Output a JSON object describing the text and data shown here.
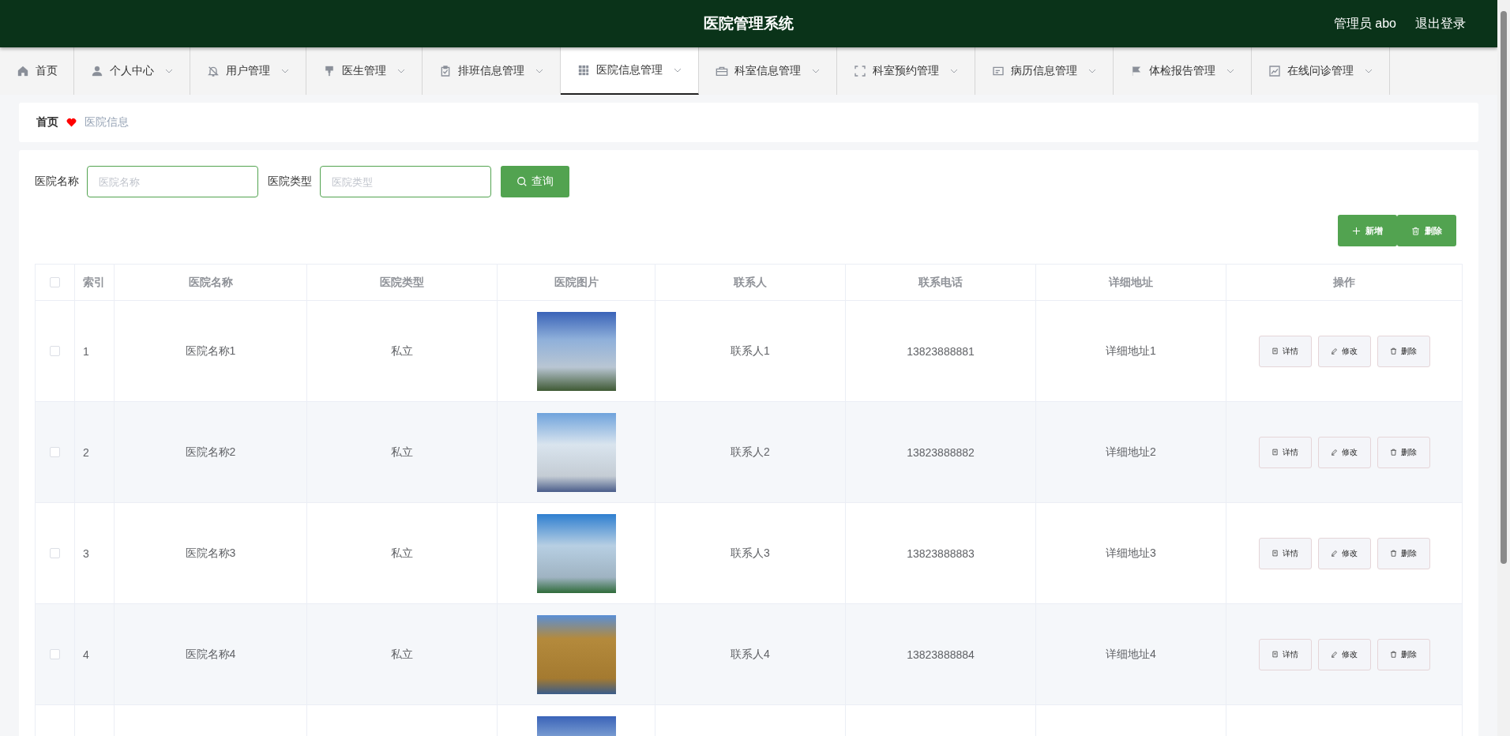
{
  "header": {
    "title": "医院管理系统",
    "user": "管理员 abo",
    "logout": "退出登录"
  },
  "nav": [
    {
      "label": "首页",
      "dropdown": false,
      "selected": false
    },
    {
      "label": "个人中心",
      "dropdown": true,
      "selected": false
    },
    {
      "label": "用户管理",
      "dropdown": true,
      "selected": false
    },
    {
      "label": "医生管理",
      "dropdown": true,
      "selected": false
    },
    {
      "label": "排班信息管理",
      "dropdown": true,
      "selected": false
    },
    {
      "label": "医院信息管理",
      "dropdown": true,
      "selected": true
    },
    {
      "label": "科室信息管理",
      "dropdown": true,
      "selected": false
    },
    {
      "label": "科室预约管理",
      "dropdown": true,
      "selected": false
    },
    {
      "label": "病历信息管理",
      "dropdown": true,
      "selected": false
    },
    {
      "label": "体检报告管理",
      "dropdown": true,
      "selected": false
    },
    {
      "label": "在线问诊管理",
      "dropdown": true,
      "selected": false
    }
  ],
  "breadcrumb": {
    "home": "首页",
    "current": "医院信息"
  },
  "search": {
    "fields": [
      {
        "label": "医院名称",
        "placeholder": "医院名称"
      },
      {
        "label": "医院类型",
        "placeholder": "医院类型"
      }
    ],
    "button": "查询"
  },
  "actions": {
    "add": "新增",
    "delete": "删除"
  },
  "table": {
    "all_checked": false,
    "columns": [
      "索引",
      "医院名称",
      "医院类型",
      "医院图片",
      "联系人",
      "联系电话",
      "详细地址",
      "操作"
    ],
    "rows": [
      {
        "checked": false,
        "index": "1",
        "name": "医院名称1",
        "type": "私立",
        "contact": "联系人1",
        "phone": "13823888881",
        "address": "详细地址1",
        "buttons": [
          "详情",
          "修改",
          "删除"
        ]
      },
      {
        "checked": false,
        "index": "2",
        "name": "医院名称2",
        "type": "私立",
        "contact": "联系人2",
        "phone": "13823888882",
        "address": "详细地址2",
        "buttons": [
          "详情",
          "修改",
          "删除"
        ]
      },
      {
        "checked": false,
        "index": "3",
        "name": "医院名称3",
        "type": "私立",
        "contact": "联系人3",
        "phone": "13823888883",
        "address": "详细地址3",
        "buttons": [
          "详情",
          "修改",
          "删除"
        ]
      },
      {
        "checked": false,
        "index": "4",
        "name": "医院名称4",
        "type": "私立",
        "contact": "联系人4",
        "phone": "13823888884",
        "address": "详细地址4",
        "buttons": [
          "详情",
          "修改",
          "删除"
        ]
      }
    ]
  }
}
